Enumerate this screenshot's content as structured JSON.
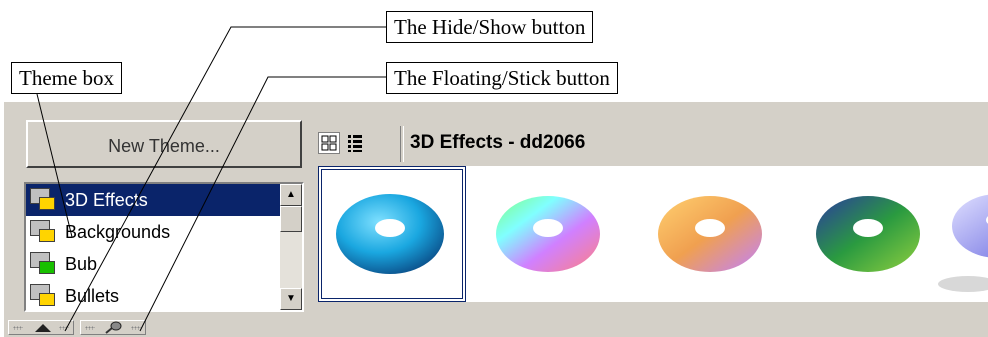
{
  "callouts": {
    "hide_show": "The Hide/Show button",
    "floating_stick": "The Floating/Stick button",
    "theme_box": "Theme box"
  },
  "gallery": {
    "new_theme_label": "New Theme...",
    "themes": [
      {
        "label": "3D Effects",
        "icon_color": "#ffd400",
        "selected": true
      },
      {
        "label": "Backgrounds",
        "icon_color": "#ffd400",
        "selected": false
      },
      {
        "label": "Bub",
        "icon_color": "#18c000",
        "selected": false
      },
      {
        "label": "Bullets",
        "icon_color": "#ffd400",
        "selected": false
      }
    ],
    "title": "3D Effects - dd2066",
    "icons": {
      "icon_view": "icon-view-icon",
      "detail_view": "detailed-view-icon",
      "hide_show": "triangle-up-icon",
      "floating_stick": "pushpin-icon"
    },
    "thumbnails": [
      {
        "name": "blue torus",
        "color": "#1aa7e0"
      },
      {
        "name": "rainbow torus",
        "color": "#d0a0ff"
      },
      {
        "name": "orange torus",
        "color": "#f0a050"
      },
      {
        "name": "green-blue torus",
        "color": "#2a9a40"
      },
      {
        "name": "lavender torus",
        "color": "#9a9af0"
      }
    ]
  }
}
